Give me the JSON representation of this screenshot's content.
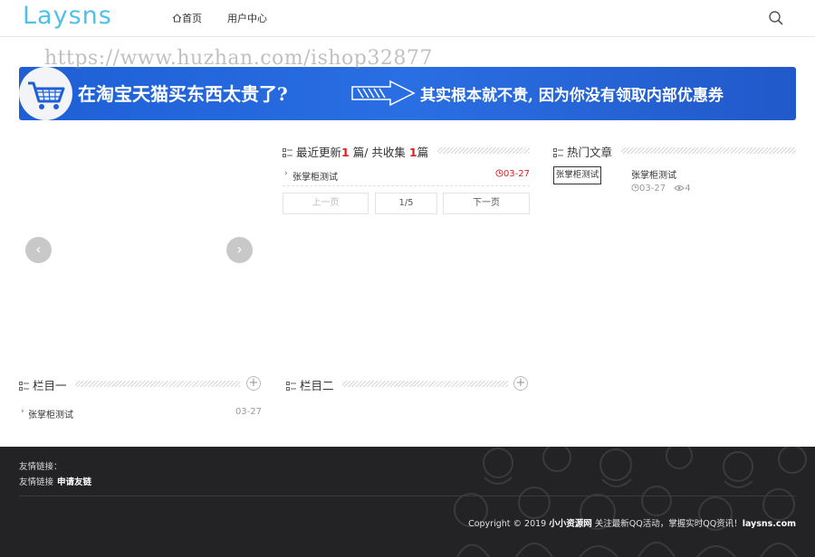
{
  "header": {
    "logo": "Laysns",
    "nav": [
      {
        "label": "首页"
      },
      {
        "label": "用户中心"
      }
    ]
  },
  "watermark": "https://www.huzhan.com/ishop32877",
  "banner": {
    "text_main": "在淘宝天猫买东西太贵了?",
    "text_sub": "其实根本就不贵, 因为你没有领取内部优惠券"
  },
  "slider": {
    "prev_icon": "chevron-left-icon",
    "next_icon": "chevron-right-icon",
    "prev_glyph": "‹",
    "next_glyph": "›"
  },
  "recent": {
    "title_prefix": "最近更新",
    "updated_count": "1",
    "title_mid": "篇/ 共收集 ",
    "total_count": "1",
    "title_suffix": "篇",
    "items": [
      {
        "title": "张掌柜测试",
        "date": "03-27"
      }
    ],
    "pager": {
      "prev": "上一页",
      "current": "1/5",
      "next": "下一页"
    }
  },
  "hot": {
    "title": "热门文章",
    "items": [
      {
        "thumb_text": "张掌柜测试",
        "title": "张掌柜测试",
        "date": "03-27",
        "views": "4"
      }
    ]
  },
  "columns": [
    {
      "title": "栏目一",
      "items": [
        {
          "title": "张掌柜测试",
          "date": "03-27"
        }
      ]
    },
    {
      "title": "栏目二",
      "items": []
    }
  ],
  "footer": {
    "links_label": "友情链接：",
    "links": [
      {
        "label": "友情链接"
      }
    ],
    "apply_link": "申请友链",
    "copyright_prefix": "Copyright © 2019 ",
    "site_name": "小小资源网",
    "copyright_middle": " 关注最新QQ活动，掌握实时QQ资讯！",
    "domain": "laysns.com"
  },
  "colors": {
    "accent_logo": "#4fc1e9",
    "banner_blue": "#2a6ee3",
    "date_red": "#e02020",
    "footer_bg": "#232325"
  }
}
